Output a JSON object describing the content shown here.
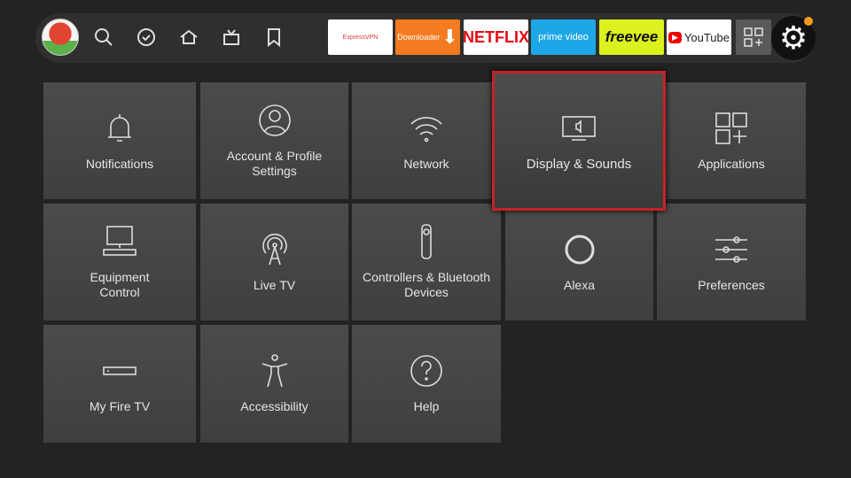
{
  "topbar": {
    "nav_icons": [
      "profile-avatar",
      "search-icon",
      "check-circle-icon",
      "home-icon",
      "live-tv-icon",
      "bookmark-icon"
    ],
    "apps": [
      {
        "label": "ExpressVPN",
        "bg": "#ffffff",
        "color": "#da3940"
      },
      {
        "label": "Downloader",
        "bg": "#f47b20",
        "color": "#ffffff"
      },
      {
        "label": "NETFLIX",
        "bg": "#ffffff",
        "color": "#e50914"
      },
      {
        "label": "prime video",
        "bg": "#1ea7e6",
        "color": "#ffffff"
      },
      {
        "label": "freevee",
        "bg": "#dcf21e",
        "color": "#0d0d0d"
      },
      {
        "label": "YouTube",
        "bg": "#ffffff",
        "color": "#222222"
      }
    ],
    "all_apps_icon": "apps-grid-icon",
    "settings_icon": "gear-icon",
    "notification_dot_color": "#f39a1e"
  },
  "tiles": [
    {
      "label": "Notifications",
      "icon": "bell-icon"
    },
    {
      "label": "Account & Profile Settings",
      "icon": "person-icon"
    },
    {
      "label": "Network",
      "icon": "wifi-icon"
    },
    {
      "label": "Display & Sounds",
      "icon": "display-icon",
      "focused": true
    },
    {
      "label": "Applications",
      "icon": "apps-icon"
    },
    {
      "label": "Equipment Control",
      "icon": "equipment-icon"
    },
    {
      "label": "Live TV",
      "icon": "antenna-icon"
    },
    {
      "label": "Controllers & Bluetooth Devices",
      "icon": "remote-icon"
    },
    {
      "label": "Alexa",
      "icon": "alexa-icon"
    },
    {
      "label": "Preferences",
      "icon": "sliders-icon"
    },
    {
      "label": "My Fire TV",
      "icon": "fire-tv-icon"
    },
    {
      "label": "Accessibility",
      "icon": "accessibility-icon"
    },
    {
      "label": "Help",
      "icon": "help-icon"
    }
  ],
  "focus_color": "#c8202a"
}
